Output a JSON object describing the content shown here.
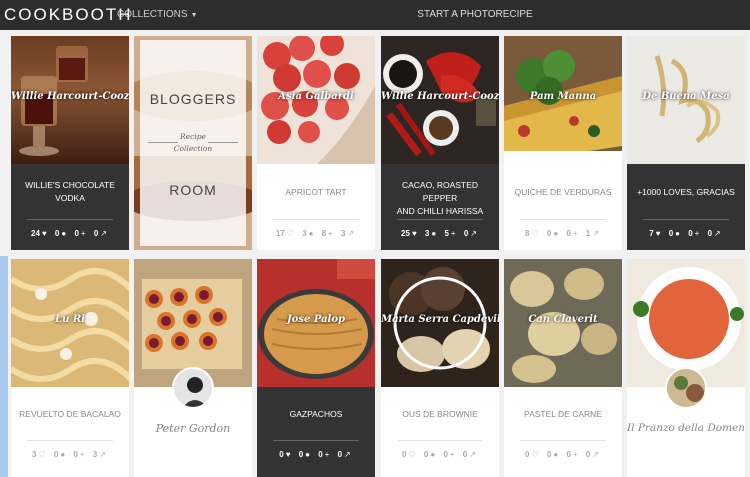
{
  "nav": {
    "logo": "COOKBOOTH",
    "collections": "COLLECTIONS",
    "start": "START A PHOTORECIPE"
  },
  "blogger_room": {
    "line1": "BLOGGERS",
    "line2": "Recipe",
    "line3": "Collection",
    "line4": "ROOM"
  },
  "row1": [
    {
      "author": "Willie Harcourt-Cooze",
      "title1": "WILLIE'S CHOCOLATE",
      "title2": "VODKA",
      "likes": "24",
      "comments": "0",
      "adds": "0",
      "shares": "0"
    },
    {
      "author": "Asia Galbardi",
      "title1": "APRICOT TART",
      "title2": "",
      "likes": "17",
      "comments": "3",
      "adds": "8",
      "shares": "3"
    },
    {
      "author": "Willie Harcourt-Cooze",
      "title1": "CACAO, ROASTED PEPPER",
      "title2": "AND CHILLI HARISSA",
      "likes": "25",
      "comments": "3",
      "adds": "5",
      "shares": "0"
    },
    {
      "author": "Pam Manna",
      "title1": "QUICHE DE VERDURAS",
      "title2": "",
      "likes": "8",
      "comments": "0",
      "adds": "0",
      "shares": "1"
    },
    {
      "author": "De Buena Mesa",
      "title1": "+1000 LOVES, GRACIAS",
      "title2": "",
      "likes": "7",
      "comments": "0",
      "adds": "0",
      "shares": "0"
    }
  ],
  "row2": [
    {
      "author": "Lu Ri",
      "title": "REVUELTO DE BACALAO",
      "likes": "3",
      "comments": "0",
      "adds": "0",
      "shares": "3"
    },
    {
      "signature": "Peter Gordon"
    },
    {
      "author": "Jose Palop",
      "title": "GAZPACHOS",
      "likes": "0",
      "comments": "0",
      "adds": "0",
      "shares": "0"
    },
    {
      "author": "Marta Serra Capdevila",
      "title": "OUS DE BROWNIE",
      "likes": "0",
      "comments": "0",
      "adds": "0",
      "shares": "0"
    },
    {
      "author": "Can Claverit",
      "title": "PASTEL DE CARNE",
      "likes": "0",
      "comments": "0",
      "adds": "0",
      "shares": "0"
    },
    {
      "signature": "Il Pranzo della Domenica"
    }
  ],
  "icons": {
    "like": "heart-icon",
    "comment": "comment-icon",
    "add": "plus-icon",
    "share": "share-icon"
  }
}
